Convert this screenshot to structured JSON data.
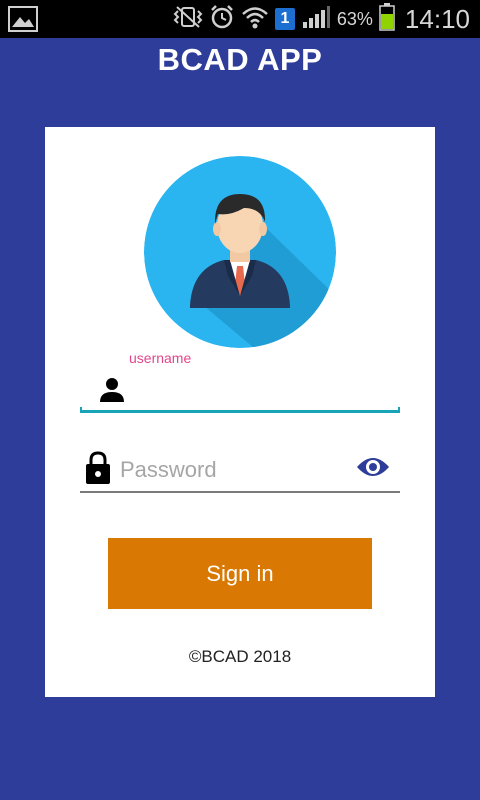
{
  "status_bar": {
    "battery_percent": "63%",
    "time": "14:10",
    "sim_slot": "1",
    "icons": [
      "gallery-icon",
      "vibrate-icon",
      "alarm-icon",
      "wifi-icon",
      "sim-icon",
      "signal-icon",
      "battery-icon"
    ]
  },
  "app": {
    "title": "BCAD APP"
  },
  "login": {
    "username_label": "username",
    "username_value": "",
    "password_placeholder": "Password",
    "signin_label": "Sign in",
    "copyright": "©BCAD 2018"
  },
  "colors": {
    "background": "#2e3d9a",
    "accent_button": "#d97803",
    "focus_line": "#17a3b8",
    "label_pink": "#e0468d",
    "avatar_circle": "#2bb5f0"
  }
}
